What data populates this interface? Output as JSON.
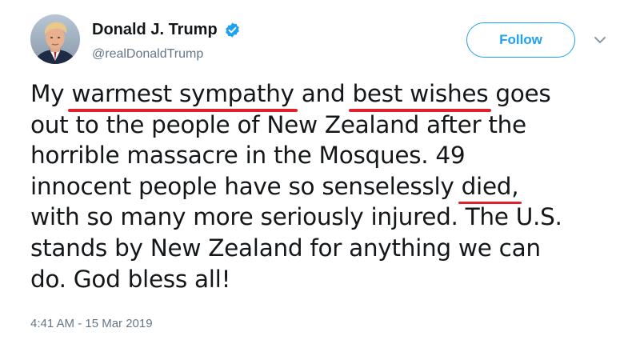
{
  "author": {
    "display_name": "Donald J. Trump",
    "handle": "@realDonaldTrump",
    "verified": true,
    "verified_icon": "verified-badge-icon",
    "avatar_icon": "avatar"
  },
  "actions": {
    "follow_label": "Follow",
    "menu_icon": "chevron-down-icon"
  },
  "tweet": {
    "lines": [
      [
        {
          "text": "My "
        },
        {
          "text": "warmest sympathy",
          "highlight": true
        },
        {
          "text": " and "
        },
        {
          "text": "best wishes",
          "highlight": true
        },
        {
          "text": " goes"
        }
      ],
      [
        {
          "text": "out to the people of New Zealand after the"
        }
      ],
      [
        {
          "text": "horrible massacre in the Mosques. 49"
        }
      ],
      [
        {
          "text": "innocent people have so senselessly "
        },
        {
          "text": "died,",
          "highlight": true
        }
      ],
      [
        {
          "text": "with so many more seriously injured. The U.S."
        }
      ],
      [
        {
          "text": "stands by New Zealand for anything we can"
        }
      ],
      [
        {
          "text": "do. God bless all!"
        }
      ]
    ],
    "timestamp": "4:41 AM - 15 Mar 2019"
  },
  "colors": {
    "accent": "#1da1f2",
    "underline": "#e0202b",
    "text": "#14171a",
    "secondary_text": "#657786"
  }
}
